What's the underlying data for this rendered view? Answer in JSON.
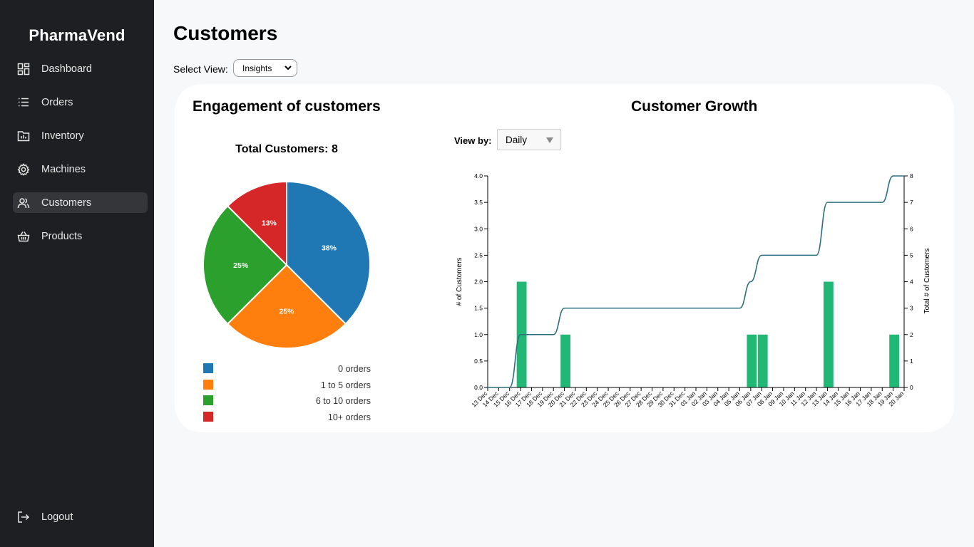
{
  "app": {
    "brand": "PharmaVend"
  },
  "sidebar": {
    "items": [
      {
        "label": "Dashboard",
        "icon": "dashboard-grid-icon"
      },
      {
        "label": "Orders",
        "icon": "list-icon"
      },
      {
        "label": "Inventory",
        "icon": "inventory-chart-icon"
      },
      {
        "label": "Machines",
        "icon": "gear-icon"
      },
      {
        "label": "Customers",
        "icon": "users-icon",
        "active": true
      },
      {
        "label": "Products",
        "icon": "basket-icon"
      }
    ],
    "logout_label": "Logout"
  },
  "page": {
    "title": "Customers",
    "select_view_label": "Select View:",
    "select_view_value": "Insights"
  },
  "engagement": {
    "title": "Engagement of customers",
    "total_label": "Total Customers: 8"
  },
  "growth": {
    "title": "Customer Growth",
    "viewby_label": "View by:",
    "viewby_value": "Daily"
  },
  "chart_data": [
    {
      "type": "pie",
      "title": "Total Customers: 8",
      "slices": [
        {
          "label": "0 orders",
          "value": 3,
          "percent_label": "38%",
          "color": "#1f77b4"
        },
        {
          "label": "1 to 5 orders",
          "value": 2,
          "percent_label": "25%",
          "color": "#ff7f0e"
        },
        {
          "label": "6 to 10 orders",
          "value": 2,
          "percent_label": "25%",
          "color": "#2ca02c"
        },
        {
          "label": "10+ orders",
          "value": 1,
          "percent_label": "13%",
          "color": "#d62728"
        }
      ],
      "legend_placement": "bottom"
    },
    {
      "type": "bar",
      "title": "Customer Growth",
      "categories": [
        "13 Dec",
        "14 Dec",
        "15 Dec",
        "16 Dec",
        "17 Dec",
        "18 Dec",
        "19 Dec",
        "20 Dec",
        "21 Dec",
        "22 Dec",
        "23 Dec",
        "24 Dec",
        "25 Dec",
        "26 Dec",
        "27 Dec",
        "28 Dec",
        "29 Dec",
        "30 Dec",
        "31 Dec",
        "01 Jan",
        "02 Jan",
        "03 Jan",
        "04 Jan",
        "05 Jan",
        "06 Jan",
        "07 Jan",
        "08 Jan",
        "09 Jan",
        "10 Jan",
        "11 Jan",
        "12 Jan",
        "13 Jan",
        "14 Jan",
        "15 Jan",
        "16 Jan",
        "17 Jan",
        "18 Jan",
        "19 Jan",
        "20 Jan"
      ],
      "series": [
        {
          "name": "# of Customers",
          "kind": "bar",
          "axis": "left",
          "color": "#21b775",
          "values": [
            0,
            0,
            0,
            2,
            0,
            0,
            0,
            1,
            0,
            0,
            0,
            0,
            0,
            0,
            0,
            0,
            0,
            0,
            0,
            0,
            0,
            0,
            0,
            0,
            1,
            1,
            0,
            0,
            0,
            0,
            0,
            2,
            0,
            0,
            0,
            0,
            0,
            1,
            0
          ]
        },
        {
          "name": "Total # of Customers",
          "kind": "line",
          "axis": "right",
          "color": "#2c6f7f",
          "values": [
            0,
            0,
            0,
            2,
            2,
            2,
            2,
            3,
            3,
            3,
            3,
            3,
            3,
            3,
            3,
            3,
            3,
            3,
            3,
            3,
            3,
            3,
            3,
            3,
            4,
            5,
            5,
            5,
            5,
            5,
            5,
            7,
            7,
            7,
            7,
            7,
            7,
            8,
            8
          ]
        }
      ],
      "ylabel": "# of Customers",
      "y2label": "Total # of Customers",
      "ylim": [
        0,
        4
      ],
      "y2lim": [
        0,
        8
      ],
      "yticks": [
        "0.0",
        "0.5",
        "1.0",
        "1.5",
        "2.0",
        "2.5",
        "3.0",
        "3.5",
        "4.0"
      ],
      "y2ticks": [
        "0",
        "1",
        "2",
        "3",
        "4",
        "5",
        "6",
        "7",
        "8"
      ],
      "grid": false
    }
  ]
}
